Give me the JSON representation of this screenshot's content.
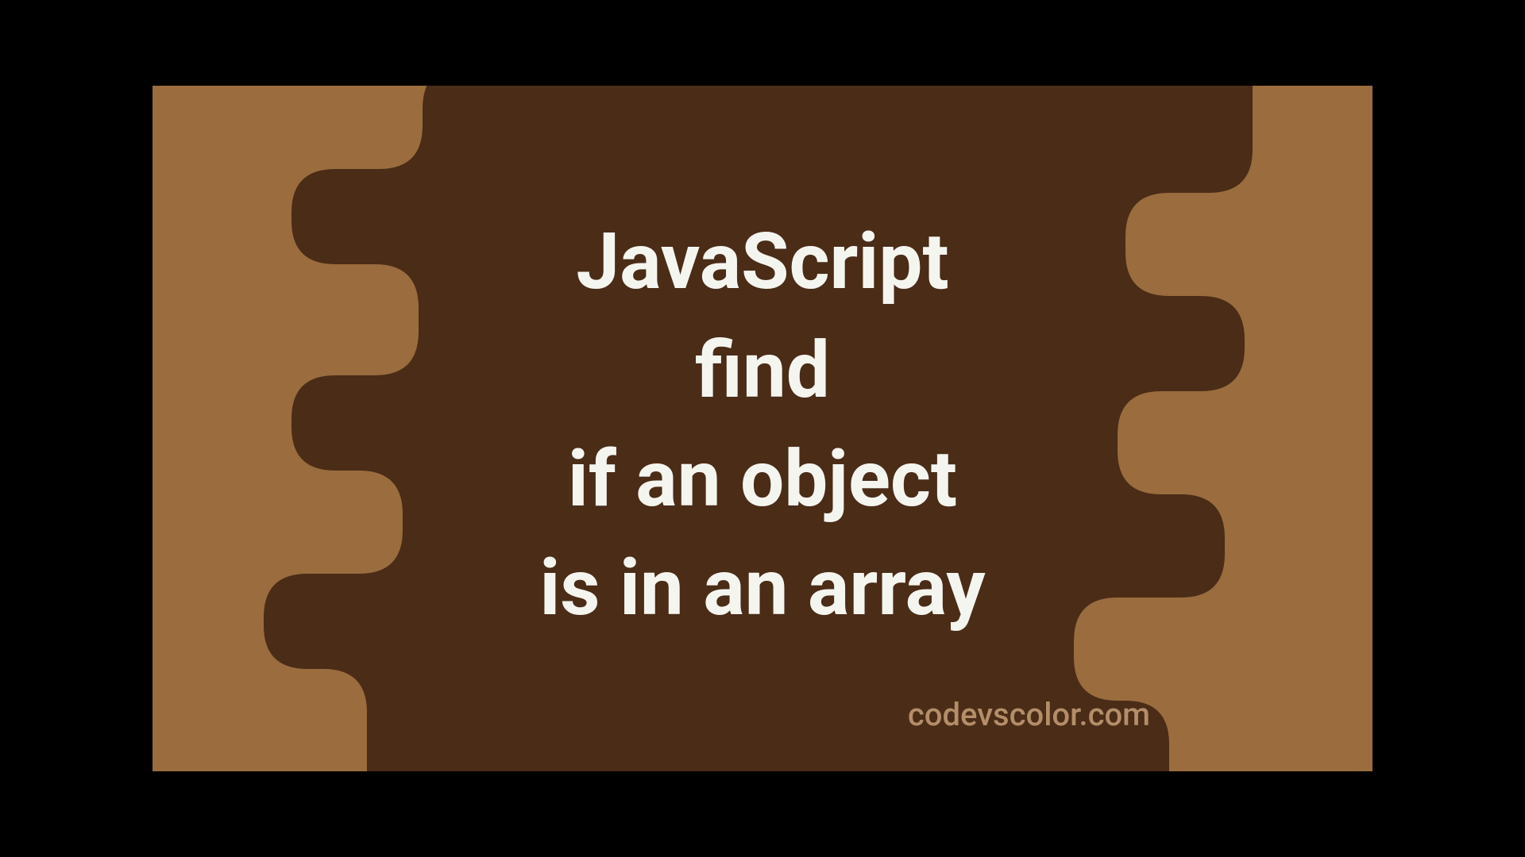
{
  "title_lines": "JavaScript\nfind\nif an object\nis in an array",
  "watermark": "codevscolor.com",
  "colors": {
    "background_light": "#9a6c3e",
    "background_dark": "#4a2c17",
    "text_primary": "#f5f5f0",
    "text_watermark": "#b38e68"
  }
}
